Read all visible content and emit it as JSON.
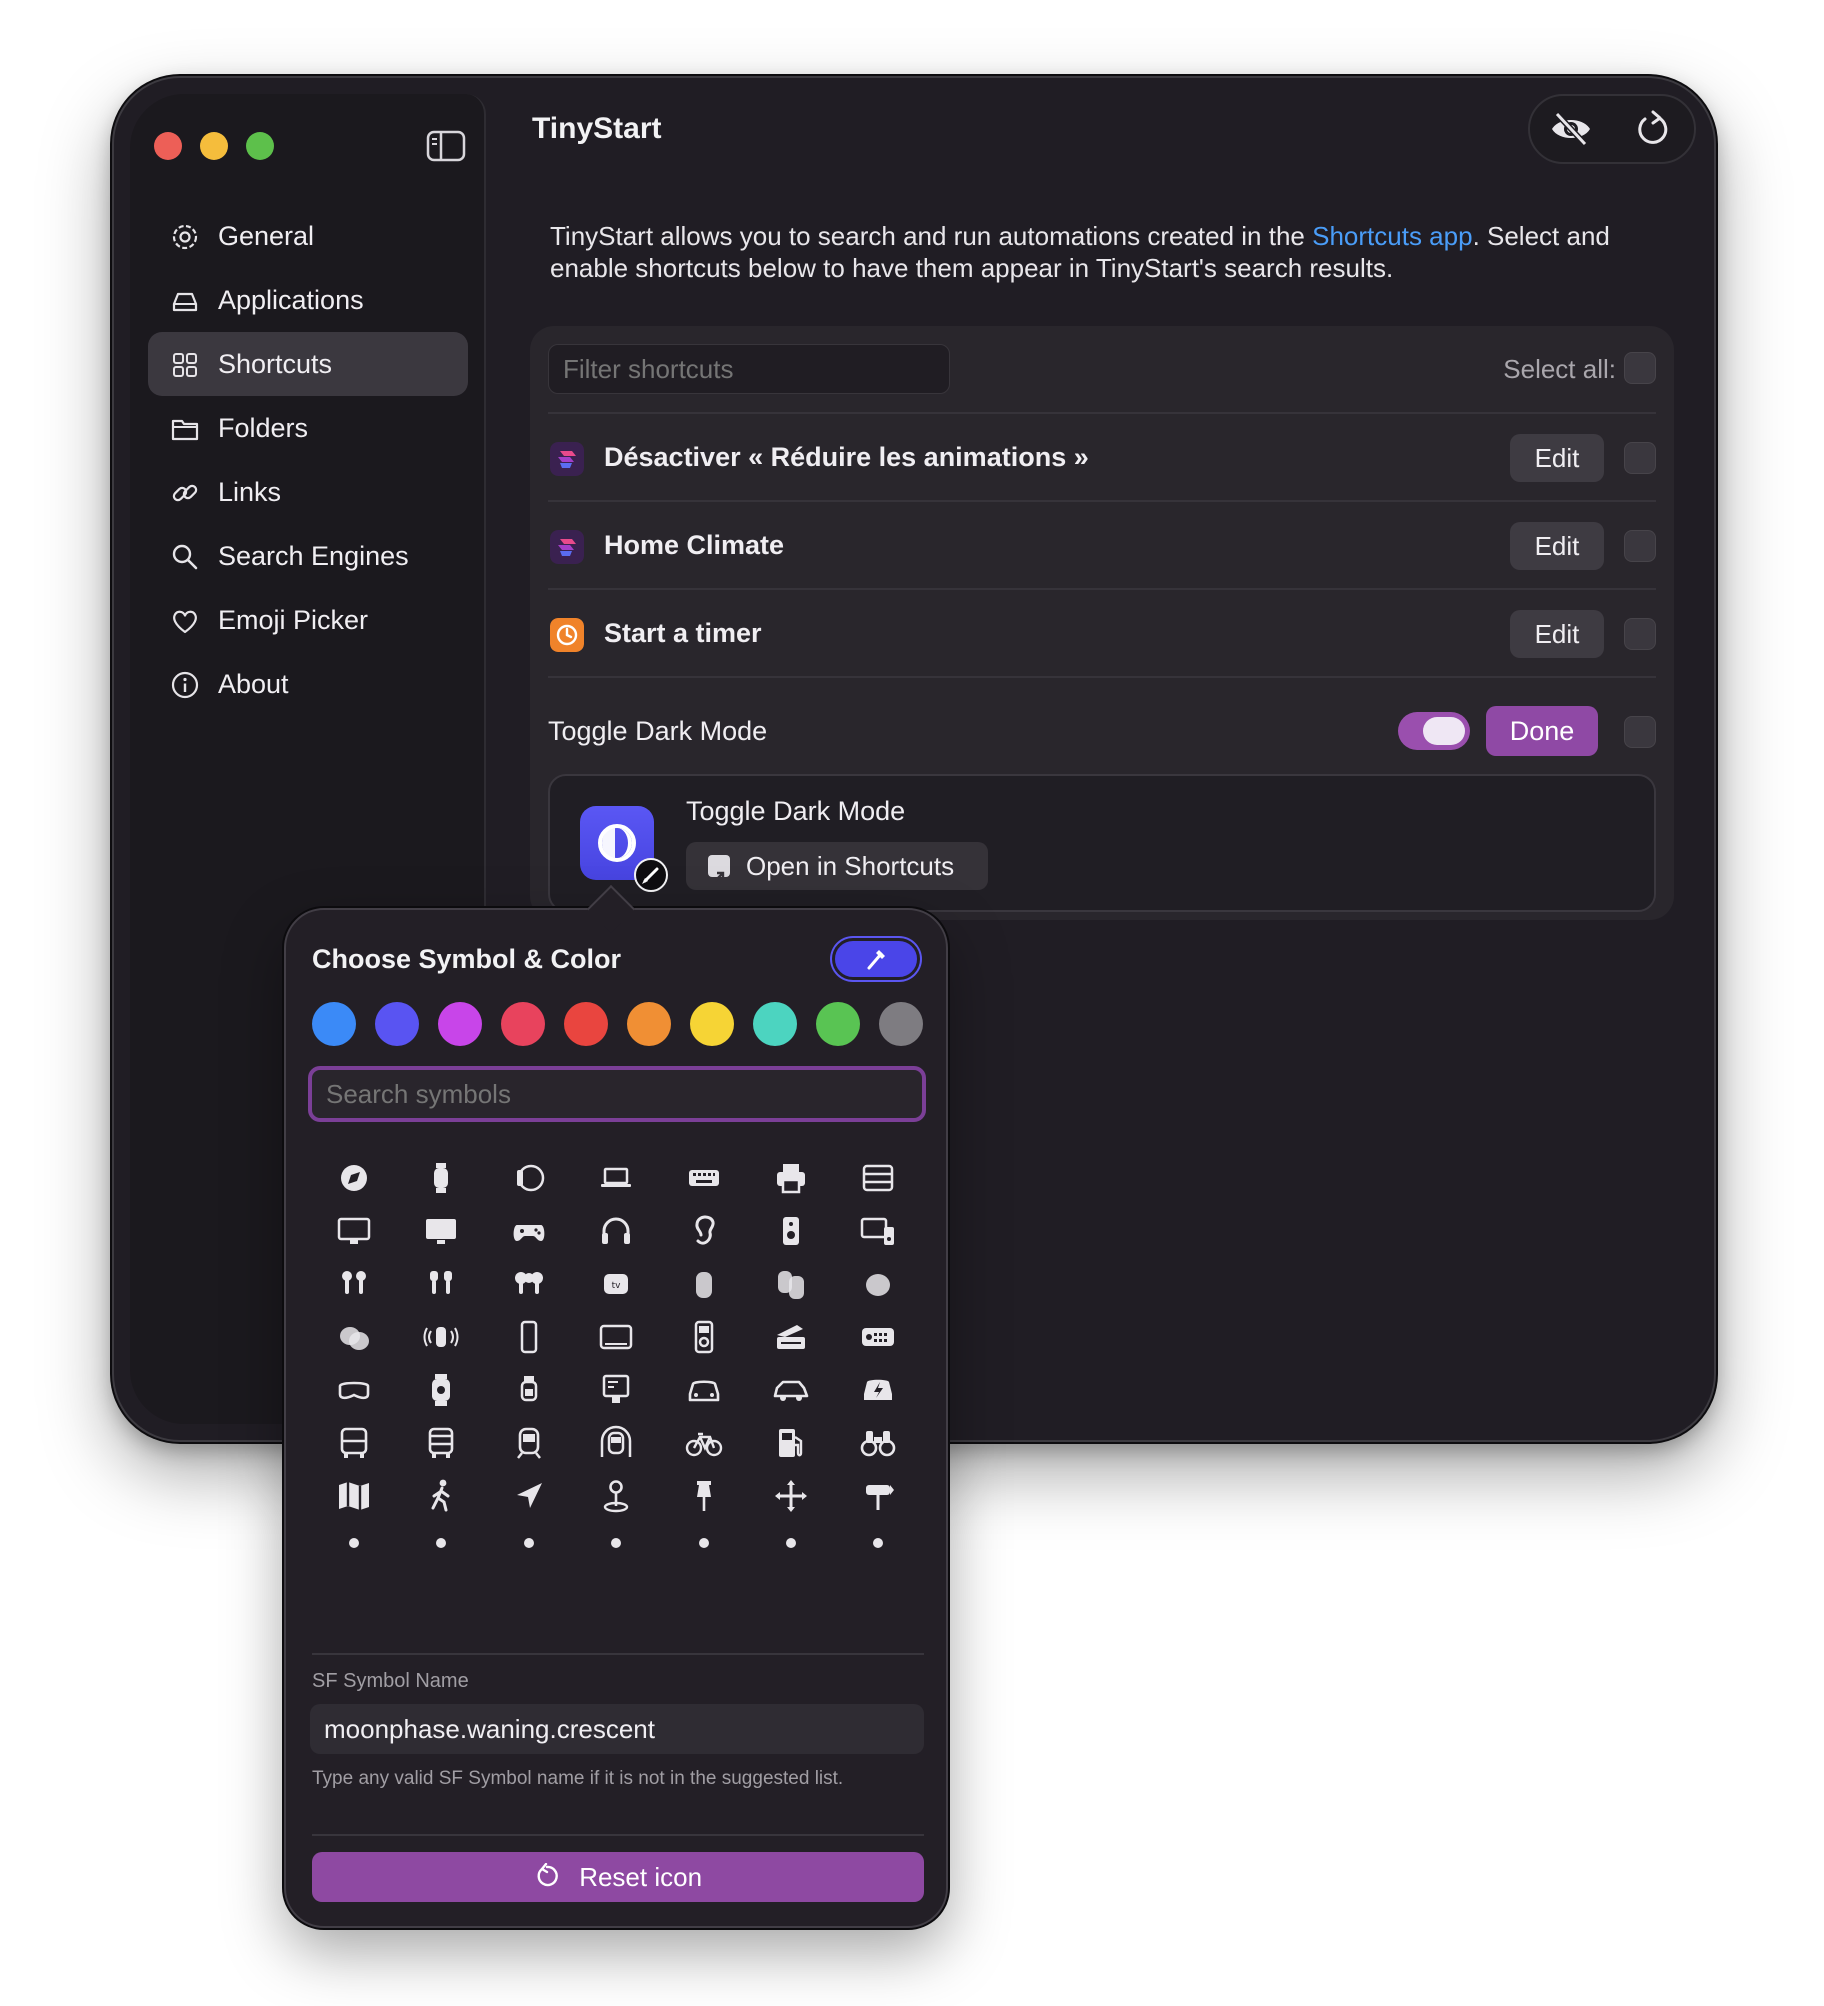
{
  "app": {
    "title": "TinyStart"
  },
  "sidebar": {
    "items": [
      {
        "label": "General",
        "icon": "gear-icon",
        "active": false
      },
      {
        "label": "Applications",
        "icon": "drive-icon",
        "active": false
      },
      {
        "label": "Shortcuts",
        "icon": "grid-icon",
        "active": true
      },
      {
        "label": "Folders",
        "icon": "folder-icon",
        "active": false
      },
      {
        "label": "Links",
        "icon": "link-icon",
        "active": false
      },
      {
        "label": "Search Engines",
        "icon": "magnifier-icon",
        "active": false
      },
      {
        "label": "Emoji Picker",
        "icon": "heart-icon",
        "active": false
      },
      {
        "label": "About",
        "icon": "info-icon",
        "active": false
      }
    ]
  },
  "toolbar": {
    "hide_icon": "eye-slash-icon",
    "refresh_icon": "refresh-icon"
  },
  "intro": {
    "text_before": "TinyStart allows you to search and run automations created in the ",
    "link": "Shortcuts app",
    "text_after": ". Select and enable shortcuts below to have them appear in TinyStart's search results."
  },
  "list": {
    "filter_placeholder": "Filter shortcuts",
    "select_all_label": "Select all:",
    "rows": [
      {
        "label": "Désactiver « Réduire les animations »",
        "edit_label": "Edit",
        "icon": "shortcuts-app-icon",
        "icon_color": "#a33fc8"
      },
      {
        "label": "Home Climate",
        "edit_label": "Edit",
        "icon": "shortcuts-app-icon",
        "icon_color": "#a33fc8"
      },
      {
        "label": "Start a timer",
        "edit_label": "Edit",
        "icon": "clock-app-icon",
        "icon_color": "#f0832a"
      }
    ],
    "editing_row": {
      "label": "Toggle Dark Mode",
      "done_label": "Done",
      "enabled": true,
      "detail_title": "Toggle Dark Mode",
      "open_label": "Open in Shortcuts",
      "icon_color": "#5451ef"
    }
  },
  "popover": {
    "title": "Choose Symbol & Color",
    "colors": [
      "#3b8af7",
      "#5954f2",
      "#c845e9",
      "#e8435d",
      "#e9453f",
      "#f08f34",
      "#f6d435",
      "#4cd4c0",
      "#59c453",
      "#7e7c81"
    ],
    "search_placeholder": "Search symbols",
    "sf_label": "SF Symbol Name",
    "sf_value": "moonphase.waning.crescent",
    "sf_help": "Type any valid SF Symbol name if it is not in the suggested list.",
    "reset_label": "Reset icon"
  },
  "theme": {
    "accent": "#8f49a5",
    "link": "#4a9df8",
    "background": "#201d24"
  }
}
